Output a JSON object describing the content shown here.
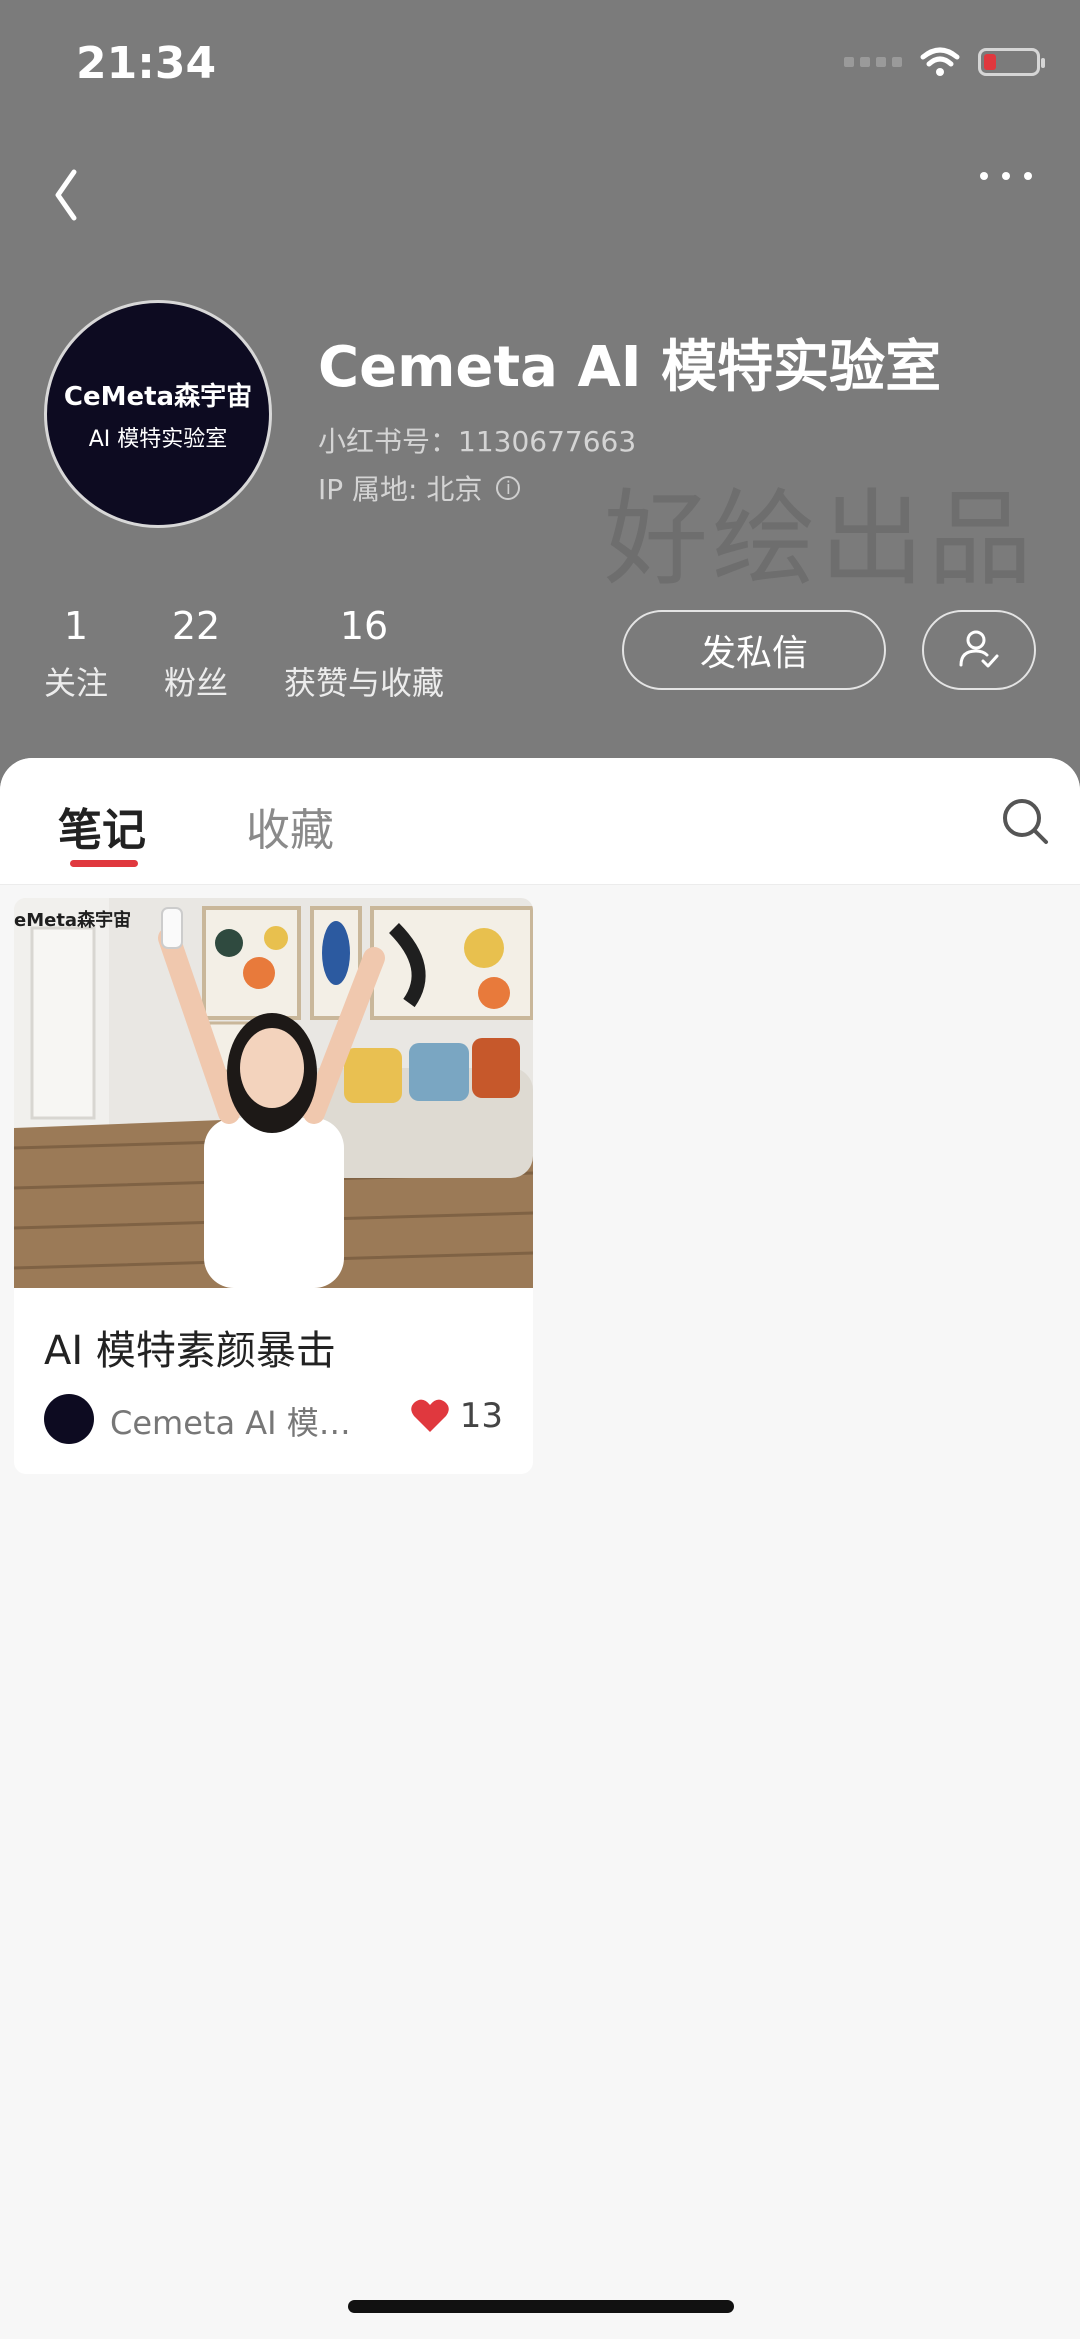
{
  "status_bar": {
    "time": "21:34"
  },
  "profile": {
    "avatar_line1": "CeMeta森宇宙",
    "avatar_line2": "AI 模特实验室",
    "name": "Cemeta AI 模特实验室",
    "xhs_id": "小红书号：1130677663",
    "ip_location": "IP 属地: 北京",
    "watermark": "好绘出品"
  },
  "stats": [
    {
      "value": "1",
      "label": "关注"
    },
    {
      "value": "22",
      "label": "粉丝"
    },
    {
      "value": "16",
      "label": "获赞与收藏"
    }
  ],
  "actions": {
    "message": "发私信"
  },
  "tabs": {
    "notes": "笔记",
    "favorites": "收藏",
    "active": "笔记"
  },
  "notes": [
    {
      "image_watermark": "eMeta森宇宙",
      "title": "AI 模特素颜暴击",
      "author": "Cemeta AI 模特...",
      "likes": "13"
    }
  ],
  "colors": {
    "header_bg": "#7b7b7b",
    "accent": "#e0383e",
    "avatar_bg": "#0d0b21"
  },
  "icons": [
    "back-icon",
    "more-icon",
    "info-icon",
    "follow-status-icon",
    "search-icon",
    "heart-icon",
    "wifi-icon",
    "signal-icon",
    "battery-icon"
  ]
}
